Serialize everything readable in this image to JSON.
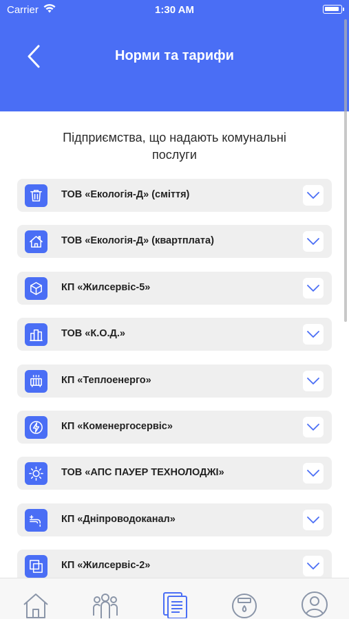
{
  "status_bar": {
    "carrier": "Carrier",
    "time": "1:30 AM"
  },
  "header": {
    "title": "Норми та тарифи"
  },
  "subtitle": "Підприємства, що надають комунальні послуги",
  "items": [
    {
      "label": "ТОВ «Екологія-Д» (сміття)",
      "icon": "trash-icon"
    },
    {
      "label": "ТОВ «Екологія-Д» (квартплата)",
      "icon": "house-icon"
    },
    {
      "label": "КП «Жилсервіс-5»",
      "icon": "box-icon"
    },
    {
      "label": "ТОВ «К.О.Д.»",
      "icon": "buildings-icon"
    },
    {
      "label": "КП «Теплоенерго»",
      "icon": "radiator-icon"
    },
    {
      "label": "КП «Коменергосервіс»",
      "icon": "lightning-icon"
    },
    {
      "label": "ТОВ «АПС ПАУЕР ТЕХНОЛОДЖІ»",
      "icon": "sun-icon"
    },
    {
      "label": "КП «Дніпроводоканал»",
      "icon": "faucet-icon"
    },
    {
      "label": "КП «Жилсервіс-2»",
      "icon": "squares-icon"
    }
  ],
  "colors": {
    "accent": "#4a6ef5",
    "row_bg": "#efefef"
  },
  "tabs": [
    "home-icon",
    "people-icon",
    "documents-icon",
    "meter-icon",
    "profile-icon"
  ]
}
